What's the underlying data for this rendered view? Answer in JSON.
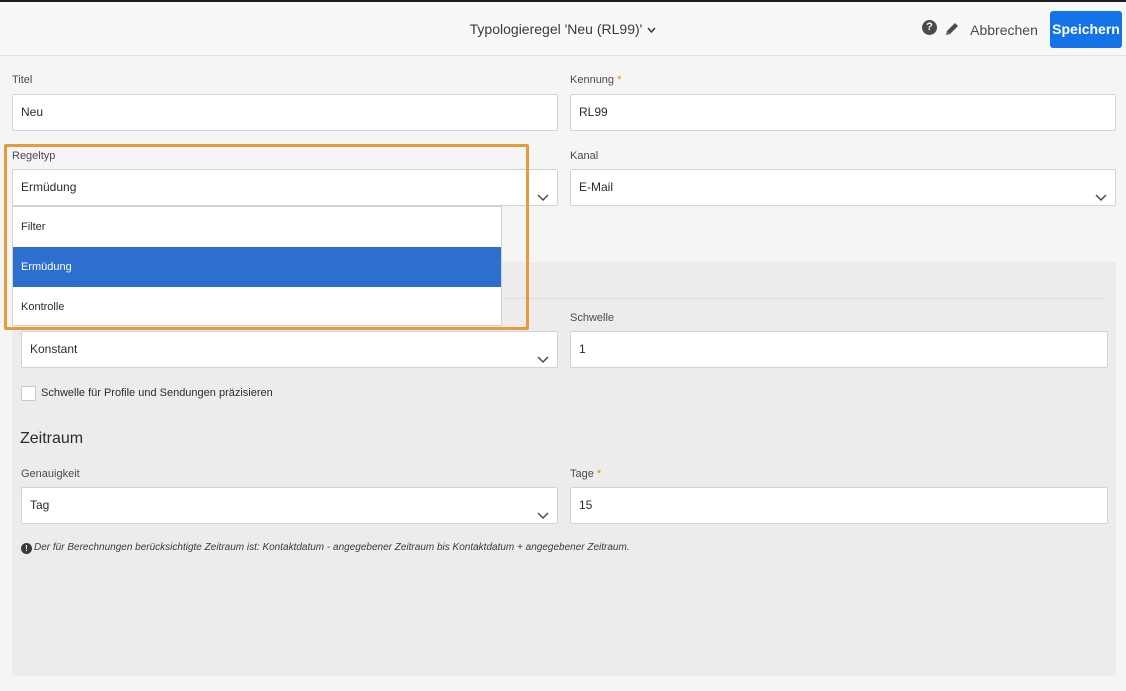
{
  "header": {
    "title": "Typologieregel 'Neu (RL99)'",
    "help_icon": "question-circle-icon",
    "edit_icon": "pencil-icon",
    "cancel_label": "Abbrechen",
    "save_label": "Speichern"
  },
  "form": {
    "titel": {
      "label": "Titel",
      "value": "Neu"
    },
    "kennung": {
      "label": "Kennung",
      "required_mark": "*",
      "value": "RL99"
    },
    "regeltyp": {
      "label": "Regeltyp",
      "value": "Ermüdung",
      "options": [
        "Filter",
        "Ermüdung",
        "Kontrolle"
      ],
      "selected_index": 1
    },
    "kanal": {
      "label": "Kanal",
      "value": "E-Mail"
    },
    "typ": {
      "value": "Konstant"
    },
    "schwelle": {
      "label": "Schwelle",
      "value": "1"
    },
    "checkbox_label": "Schwelle für Profile und Sendungen präzisieren"
  },
  "zeitraum": {
    "title": "Zeitraum",
    "genauigkeit": {
      "label": "Genauigkeit",
      "value": "Tag"
    },
    "tage": {
      "label": "Tage",
      "required_mark": "*",
      "value": "15"
    },
    "info_text": "Der für Berechnungen berücksichtigte Zeitraum ist: Kontaktdatum - angegebener Zeitraum bis Kontaktdatum + angegebener Zeitraum."
  },
  "colors": {
    "accent": "#1473e6",
    "selected_option": "#2d6fcf",
    "highlight": "#e69a3c",
    "required": "#e68619"
  }
}
